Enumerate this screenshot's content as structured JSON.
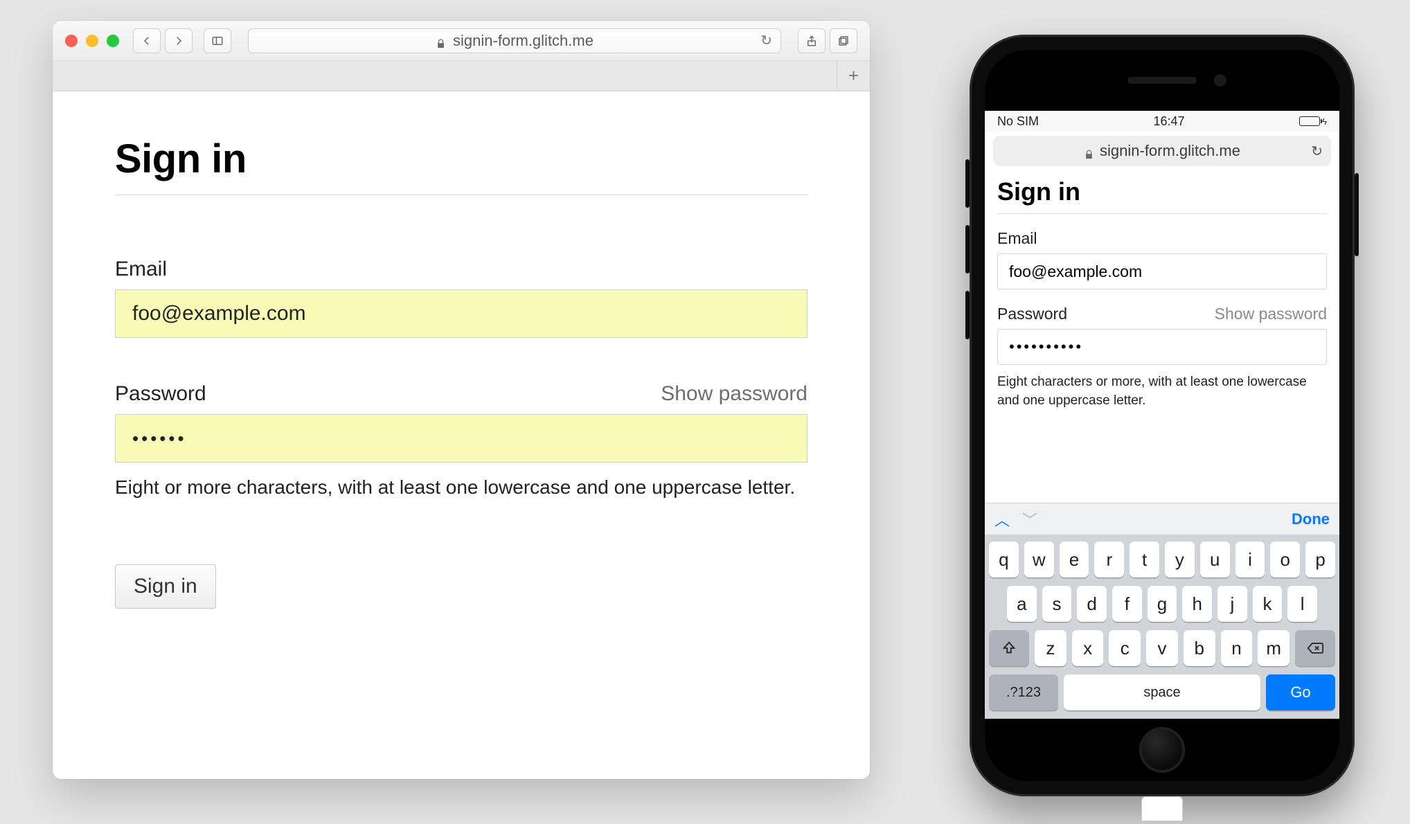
{
  "desktop": {
    "url": "signin-form.glitch.me",
    "page": {
      "title": "Sign in",
      "email_label": "Email",
      "email_value": "foo@example.com",
      "password_label": "Password",
      "show_password": "Show password",
      "password_value": "••••••",
      "password_hint": "Eight or more characters, with at least one lowercase and one uppercase letter.",
      "submit": "Sign in"
    }
  },
  "mobile": {
    "status": {
      "carrier": "No SIM",
      "time": "16:47"
    },
    "url": "signin-form.glitch.me",
    "page": {
      "title": "Sign in",
      "email_label": "Email",
      "email_value": "foo@example.com",
      "password_label": "Password",
      "show_password": "Show password",
      "password_value": "••••••••••",
      "password_hint": "Eight characters or more, with at least one lowercase and one uppercase letter."
    },
    "keyboard": {
      "done": "Done",
      "rows": [
        [
          "q",
          "w",
          "e",
          "r",
          "t",
          "y",
          "u",
          "i",
          "o",
          "p"
        ],
        [
          "a",
          "s",
          "d",
          "f",
          "g",
          "h",
          "j",
          "k",
          "l"
        ],
        [
          "z",
          "x",
          "c",
          "v",
          "b",
          "n",
          "m"
        ]
      ],
      "numbers": ".?123",
      "space": "space",
      "go": "Go"
    }
  }
}
